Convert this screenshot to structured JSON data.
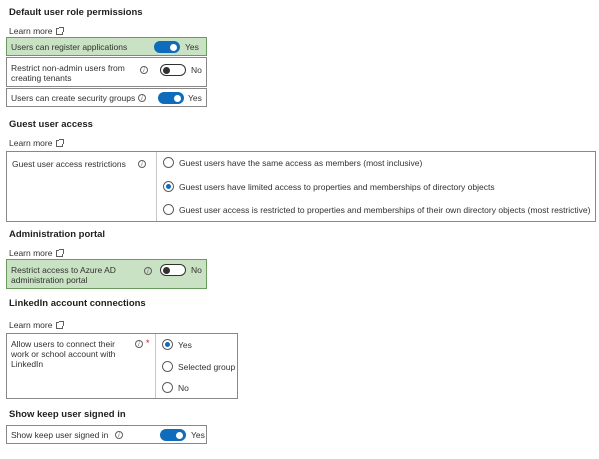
{
  "default_perms": {
    "heading": "Default user role permissions",
    "learn_more": "Learn more",
    "register_apps": {
      "label": "Users can register applications",
      "state": "Yes"
    },
    "restrict_tenants": {
      "label": "Restrict non-admin users from creating tenants",
      "state": "No"
    },
    "security_groups": {
      "label": "Users can create security groups",
      "state": "Yes"
    }
  },
  "guest_access": {
    "heading": "Guest user access",
    "learn_more": "Learn more",
    "restrictions_label": "Guest user access restrictions",
    "options": [
      "Guest users have the same access as members (most inclusive)",
      "Guest users have limited access to properties and memberships of directory objects",
      "Guest user access is restricted to properties and memberships of their own directory objects (most restrictive)"
    ],
    "selected_index": 1
  },
  "admin_portal": {
    "heading": "Administration portal",
    "learn_more": "Learn more",
    "restrict_label": "Restrict access to Azure AD administration portal",
    "state": "No"
  },
  "linkedin": {
    "heading": "LinkedIn account connections",
    "learn_more": "Learn more",
    "allow_label": "Allow users to connect their work or school account with LinkedIn",
    "required_mark": "*",
    "options": [
      "Yes",
      "Selected group",
      "No"
    ],
    "selected_index": 0
  },
  "keep_signed_in": {
    "heading": "Show keep user signed in",
    "label": "Show keep user signed in",
    "state": "Yes"
  },
  "colors": {
    "accent": "#0f6cbd",
    "highlight": "#c9e2c3"
  },
  "icons": {
    "info": "info-icon",
    "external": "external-link-icon"
  }
}
